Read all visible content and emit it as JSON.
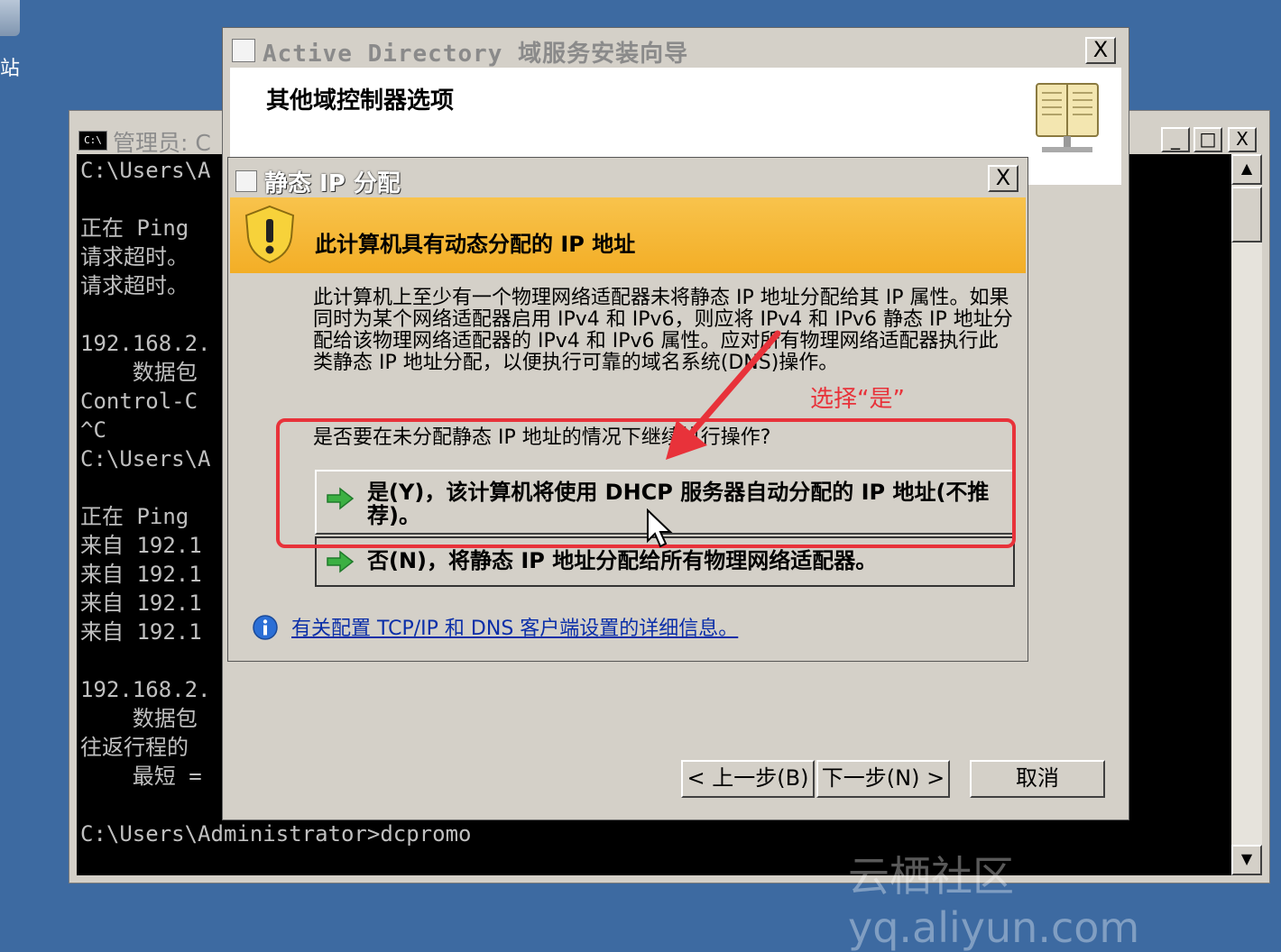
{
  "desktop": {
    "icon_label": "站"
  },
  "console": {
    "title": "管理员: C",
    "lines": [
      "C:\\Users\\A",
      "",
      "正在 Ping",
      "请求超时。",
      "请求超时。",
      "",
      "192.168.2.",
      "    数据包",
      "Control-C",
      "^C",
      "C:\\Users\\A",
      "",
      "正在 Ping",
      "来自 192.1",
      "来自 192.1",
      "来自 192.1",
      "来自 192.1",
      "",
      "192.168.2.",
      "    数据包",
      "往返行程的",
      "    最短 =",
      "",
      "C:\\Users\\Administrator>dcpromo"
    ],
    "min_label": "_",
    "max_label": "□",
    "close_label": "X",
    "scroll_up": "▲",
    "scroll_down": "▼"
  },
  "wizard": {
    "title": "Active Directory 域服务安装向导",
    "close_label": "X",
    "heading": "其他域控制器选项",
    "back_button": "< 上一步(B)",
    "next_button": "下一步(N) >",
    "cancel_button": "取消"
  },
  "dialog": {
    "title": "静态 IP 分配",
    "close_label": "X",
    "banner": "此计算机具有动态分配的 IP 地址",
    "paragraph": "此计算机上至少有一个物理网络适配器未将静态 IP 地址分配给其 IP 属性。如果同时为某个网络适配器启用 IPv4 和 IPv6，则应将 IPv4 和 IPv6 静态 IP 地址分配给该物理网络适配器的 IPv4 和 IPv6 属性。应对所有物理网络适配器执行此类静态 IP 地址分配，以便执行可靠的域名系统(DNS)操作。",
    "question": "是否要在未分配静态 IP 地址的情况下继续执行操作?",
    "option_yes": "是(Y)，该计算机将使用 DHCP 服务器自动分配的 IP 地址(不推荐)。",
    "option_no": "否(N)，将静态 IP 地址分配给所有物理网络适配器。",
    "info_link": "有关配置 TCP/IP 和 DNS 客户端设置的详细信息。"
  },
  "annotation": {
    "text": "选择“是”",
    "color": "#e8323a"
  },
  "watermark": "云栖社区 yq.aliyun.com"
}
